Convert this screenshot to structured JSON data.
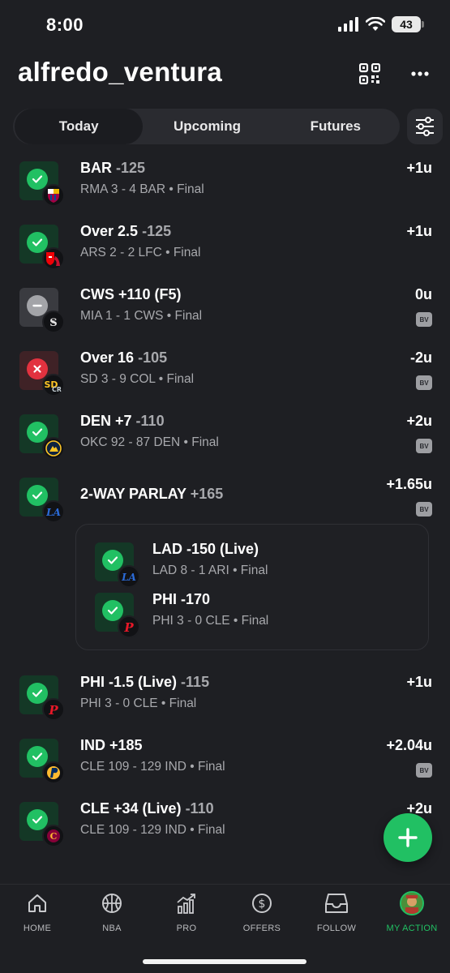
{
  "status_bar": {
    "time": "8:00",
    "battery": "43"
  },
  "header": {
    "username": "alfredo_ventura"
  },
  "tabs": [
    {
      "label": "Today",
      "active": true
    },
    {
      "label": "Upcoming",
      "active": false
    },
    {
      "label": "Futures",
      "active": false
    }
  ],
  "bets": [
    {
      "pick": "BAR",
      "odds": "-125",
      "score": "RMA 3 - 4 BAR • Final",
      "units": "+1u",
      "result": "win",
      "bv": false,
      "team_icon": "barcelona-logo-icon"
    },
    {
      "pick": "Over 2.5",
      "odds": "-125",
      "score": "ARS 2 - 2 LFC • Final",
      "units": "+1u",
      "result": "win",
      "bv": false,
      "team_icon": "arsenal-liverpool-logo-icon"
    },
    {
      "pick": "CWS +110 (F5)",
      "odds": "",
      "score": "MIA 1 - 1 CWS • Final",
      "units": "0u",
      "result": "push",
      "bv": true,
      "team_icon": "white-sox-logo-icon"
    },
    {
      "pick": "Over 16",
      "odds": "-105",
      "score": "SD 3 - 9 COL • Final",
      "units": "-2u",
      "result": "loss",
      "bv": true,
      "team_icon": "padres-rockies-logo-icon"
    },
    {
      "pick": "DEN +7",
      "odds": "-110",
      "score": "OKC 92 - 87 DEN • Final",
      "units": "+2u",
      "result": "win",
      "bv": true,
      "team_icon": "nuggets-logo-icon"
    },
    {
      "pick": "2-WAY PARLAY",
      "odds": "+165",
      "score": "",
      "units": "+1.65u",
      "result": "win",
      "bv": true,
      "team_icon": "dodgers-logo-icon"
    },
    {
      "pick": "PHI -1.5 (Live)",
      "odds": "-115",
      "score": "PHI 3 - 0 CLE • Final",
      "units": "+1u",
      "result": "win",
      "bv": false,
      "team_icon": "phillies-logo-icon"
    },
    {
      "pick": "IND +185",
      "odds": "",
      "score": "CLE 109 - 129 IND • Final",
      "units": "+2.04u",
      "result": "win",
      "bv": true,
      "team_icon": "pacers-logo-icon"
    },
    {
      "pick": "CLE +34 (Live)",
      "odds": "-110",
      "score": "CLE 109 - 129 IND • Final",
      "units": "+2u",
      "result": "win",
      "bv": false,
      "team_icon": "cavaliers-logo-icon"
    }
  ],
  "parlay_legs": [
    {
      "pick": "LAD -150 (Live)",
      "score": "LAD 8 - 1 ARI • Final",
      "result": "win",
      "team_icon": "dodgers-logo-icon"
    },
    {
      "pick": "PHI -170",
      "score": "PHI 3 - 0 CLE • Final",
      "result": "win",
      "team_icon": "phillies-logo-icon"
    }
  ],
  "bv_label": "BV",
  "nav": [
    {
      "label": "HOME",
      "icon": "home-icon",
      "active": false
    },
    {
      "label": "NBA",
      "icon": "basketball-icon",
      "active": false
    },
    {
      "label": "PRO",
      "icon": "chart-growth-icon",
      "active": false
    },
    {
      "label": "OFFERS",
      "icon": "dollar-coin-icon",
      "active": false
    },
    {
      "label": "FOLLOW",
      "icon": "inbox-tray-icon",
      "active": false
    },
    {
      "label": "MY ACTION",
      "icon": "avatar",
      "active": true
    }
  ],
  "colors": {
    "accent": "#21c063",
    "loss": "#e2323f",
    "push": "#a3a4a8",
    "background": "#1e1f23"
  }
}
